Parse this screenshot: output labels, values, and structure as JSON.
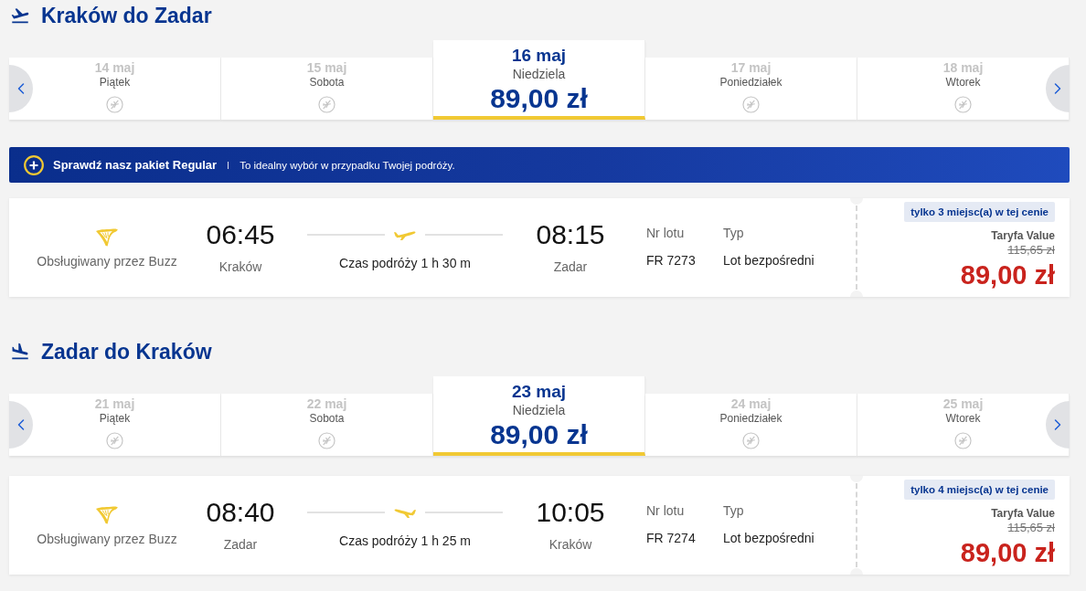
{
  "sections": [
    {
      "kind": "outbound",
      "title": "Kraków do Zadar",
      "dates": [
        {
          "date": "14 maj",
          "weekday": "Piątek",
          "selected": false
        },
        {
          "date": "15 maj",
          "weekday": "Sobota",
          "selected": false
        },
        {
          "date": "16 maj",
          "weekday": "Niedziela",
          "price": "89,00 zł",
          "selected": true
        },
        {
          "date": "17 maj",
          "weekday": "Poniedziałek",
          "selected": false
        },
        {
          "date": "18 maj",
          "weekday": "Wtorek",
          "selected": false
        }
      ],
      "promo": {
        "title": "Sprawdź nasz pakiet Regular",
        "text": "To idealny wybór w przypadku Twojej podróży."
      },
      "flight": {
        "operator": "Obsługiwany przez Buzz",
        "departure_time": "06:45",
        "departure_city": "Kraków",
        "duration": "Czas podróży 1 h 30 m",
        "arrival_time": "08:15",
        "arrival_city": "Zadar",
        "flight_number_label": "Nr lotu",
        "flight_number": "FR 7273",
        "type_label": "Typ",
        "type": "Lot bezpośredni",
        "seats_note": "tylko 3 miejsc(a) w tej cenie",
        "fare": "Taryfa Value",
        "old_price": "115,65 zł",
        "price": "89,00 zł"
      }
    },
    {
      "kind": "return",
      "title": "Zadar do Kraków",
      "dates": [
        {
          "date": "21 maj",
          "weekday": "Piątek",
          "selected": false
        },
        {
          "date": "22 maj",
          "weekday": "Sobota",
          "selected": false
        },
        {
          "date": "23 maj",
          "weekday": "Niedziela",
          "price": "89,00 zł",
          "selected": true
        },
        {
          "date": "24 maj",
          "weekday": "Poniedziałek",
          "selected": false
        },
        {
          "date": "25 maj",
          "weekday": "Wtorek",
          "selected": false
        }
      ],
      "flight": {
        "operator": "Obsługiwany przez Buzz",
        "departure_time": "08:40",
        "departure_city": "Zadar",
        "duration": "Czas podróży 1 h 25 m",
        "arrival_time": "10:05",
        "arrival_city": "Kraków",
        "flight_number_label": "Nr lotu",
        "flight_number": "FR 7274",
        "type_label": "Typ",
        "type": "Lot bezpośredni",
        "seats_note": "tylko 4 miejsc(a) w tej cenie",
        "fare": "Taryfa Value",
        "old_price": "115,65 zł",
        "price": "89,00 zł"
      }
    }
  ]
}
